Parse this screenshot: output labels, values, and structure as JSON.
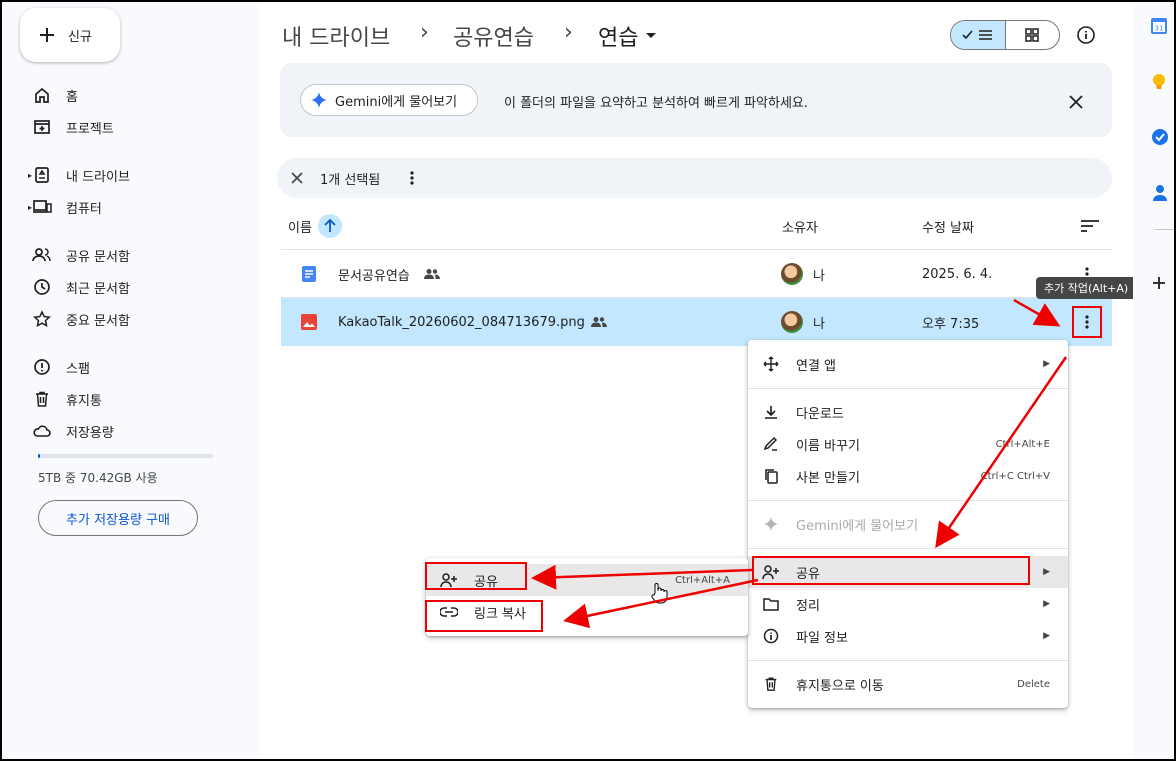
{
  "sidebar": {
    "new_label": "신규",
    "items": [
      {
        "label": "홈",
        "icon": "home-icon"
      },
      {
        "label": "프로젝트",
        "icon": "projects-icon"
      },
      {
        "label": "내 드라이브",
        "icon": "drive-icon"
      },
      {
        "label": "컴퓨터",
        "icon": "computer-icon"
      },
      {
        "label": "공유 문서함",
        "icon": "shared-icon"
      },
      {
        "label": "최근 문서함",
        "icon": "clock-icon"
      },
      {
        "label": "중요 문서함",
        "icon": "star-icon"
      },
      {
        "label": "스팸",
        "icon": "spam-icon"
      },
      {
        "label": "휴지통",
        "icon": "trash-icon"
      },
      {
        "label": "저장용량",
        "icon": "cloud-icon"
      }
    ],
    "storage_text": "5TB 중 70.42GB 사용",
    "storage_fraction": 0.014,
    "buy_label": "추가 저장용량 구매"
  },
  "breadcrumb": {
    "root": "내 드라이브",
    "sep": "›",
    "mid": "공유연습",
    "current": "연습"
  },
  "gemini": {
    "pill": "Gemini에게 물어보기",
    "text": "이 폴더의 파일을 요약하고 분석하여 빠르게 파악하세요."
  },
  "selection": {
    "count": "1개 선택됨"
  },
  "table": {
    "col_name": "이름",
    "col_owner": "소유자",
    "col_modified": "수정 날짜",
    "rows": [
      {
        "name": "문서공유연습",
        "owner": "나",
        "modified": "2025. 6. 4.",
        "icon": "docs-icon",
        "shared": true
      },
      {
        "name": "KakaoTalk_20260602_084713679.png",
        "owner": "나",
        "modified": "오후 7:35",
        "icon": "image-icon",
        "shared": true
      }
    ]
  },
  "tooltip": "추가 작업(Alt+A)",
  "context_menu": [
    {
      "label": "연결 앱",
      "icon": "apps-icon",
      "submenu": true
    },
    {
      "label": "다운로드",
      "icon": "download-icon"
    },
    {
      "label": "이름 바꾸기",
      "icon": "rename-icon",
      "shortcut": "Ctrl+Alt+E"
    },
    {
      "label": "사본 만들기",
      "icon": "copy-icon",
      "shortcut": "Ctrl+C Ctrl+V"
    },
    {
      "label": "Gemini에게 물어보기",
      "icon": "gemini-icon",
      "disabled": true
    },
    {
      "label": "공유",
      "icon": "share-icon",
      "submenu": true
    },
    {
      "label": "정리",
      "icon": "folder-icon",
      "submenu": true
    },
    {
      "label": "파일 정보",
      "icon": "info-icon",
      "submenu": true
    },
    {
      "label": "휴지통으로 이동",
      "icon": "trash-icon",
      "shortcut": "Delete"
    }
  ],
  "share_submenu": [
    {
      "label": "공유",
      "icon": "share-icon",
      "shortcut": "Ctrl+Alt+A"
    },
    {
      "label": "링크 복사",
      "icon": "link-icon"
    }
  ],
  "colors": {
    "accent": "#0b57d0",
    "selected_row": "#c2e7ff",
    "annotation": "#e00000"
  }
}
